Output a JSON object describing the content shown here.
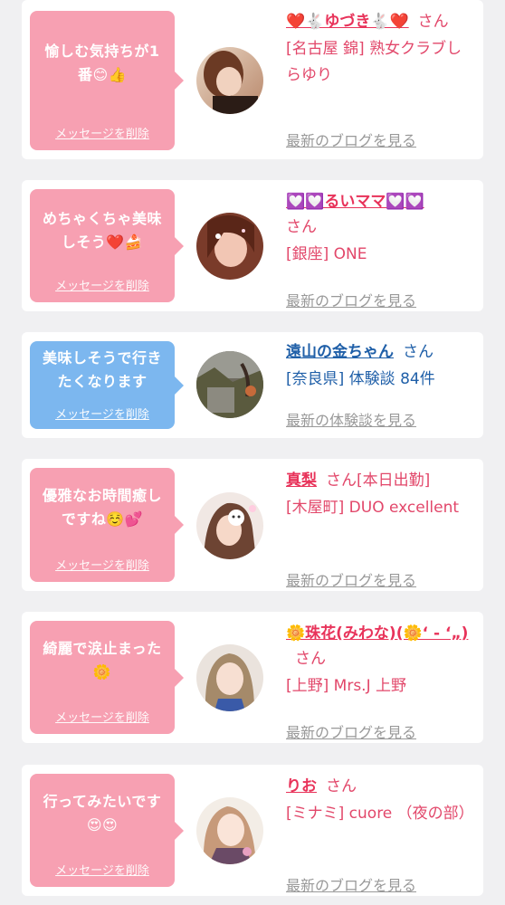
{
  "cards": [
    {
      "message": "愉しむ気持ちが1番😊👍",
      "delete_label": "メッセージを削除",
      "name": "❤️🐇ゆづき🐇❤️",
      "honorific": "さん",
      "store": "[名古屋 錦] 熟女クラブしらゆり",
      "link": "最新のブログを見る",
      "theme": "pink"
    },
    {
      "message": "めちゃくちゃ美味しそう❤️🍰",
      "delete_label": "メッセージを削除",
      "name": "💟💟るいママ💟💟",
      "honorific": "さん",
      "store": "[銀座] ONE",
      "link": "最新のブログを見る",
      "theme": "pink"
    },
    {
      "message": "美味しそうで行きたくなります",
      "delete_label": "メッセージを削除",
      "name": "遠山の金ちゃん",
      "honorific": "さん",
      "store": "[奈良県] 体験談 84件",
      "link": "最新の体験談を見る",
      "theme": "blue"
    },
    {
      "message": "優雅なお時間癒しですね☺️💕",
      "delete_label": "メッセージを削除",
      "name": "真梨",
      "honorific": "さん[本日出勤]",
      "store": "[木屋町] DUO excellent",
      "link": "最新のブログを見る",
      "theme": "pink"
    },
    {
      "message": "綺麗で涙止まった🌼",
      "delete_label": "メッセージを削除",
      "name": "🌼珠花(みわな)(🌼‘ - ‘„)",
      "honorific": "さん",
      "store": "[上野] Mrs.J 上野",
      "link": "最新のブログを見る",
      "theme": "pink"
    },
    {
      "message": "行ってみたいです😍😍",
      "delete_label": "メッセージを削除",
      "name": "りお",
      "honorific": "さん",
      "store": "[ミナミ] cuore （夜の部）",
      "link": "最新のブログを見る",
      "theme": "pink"
    }
  ]
}
